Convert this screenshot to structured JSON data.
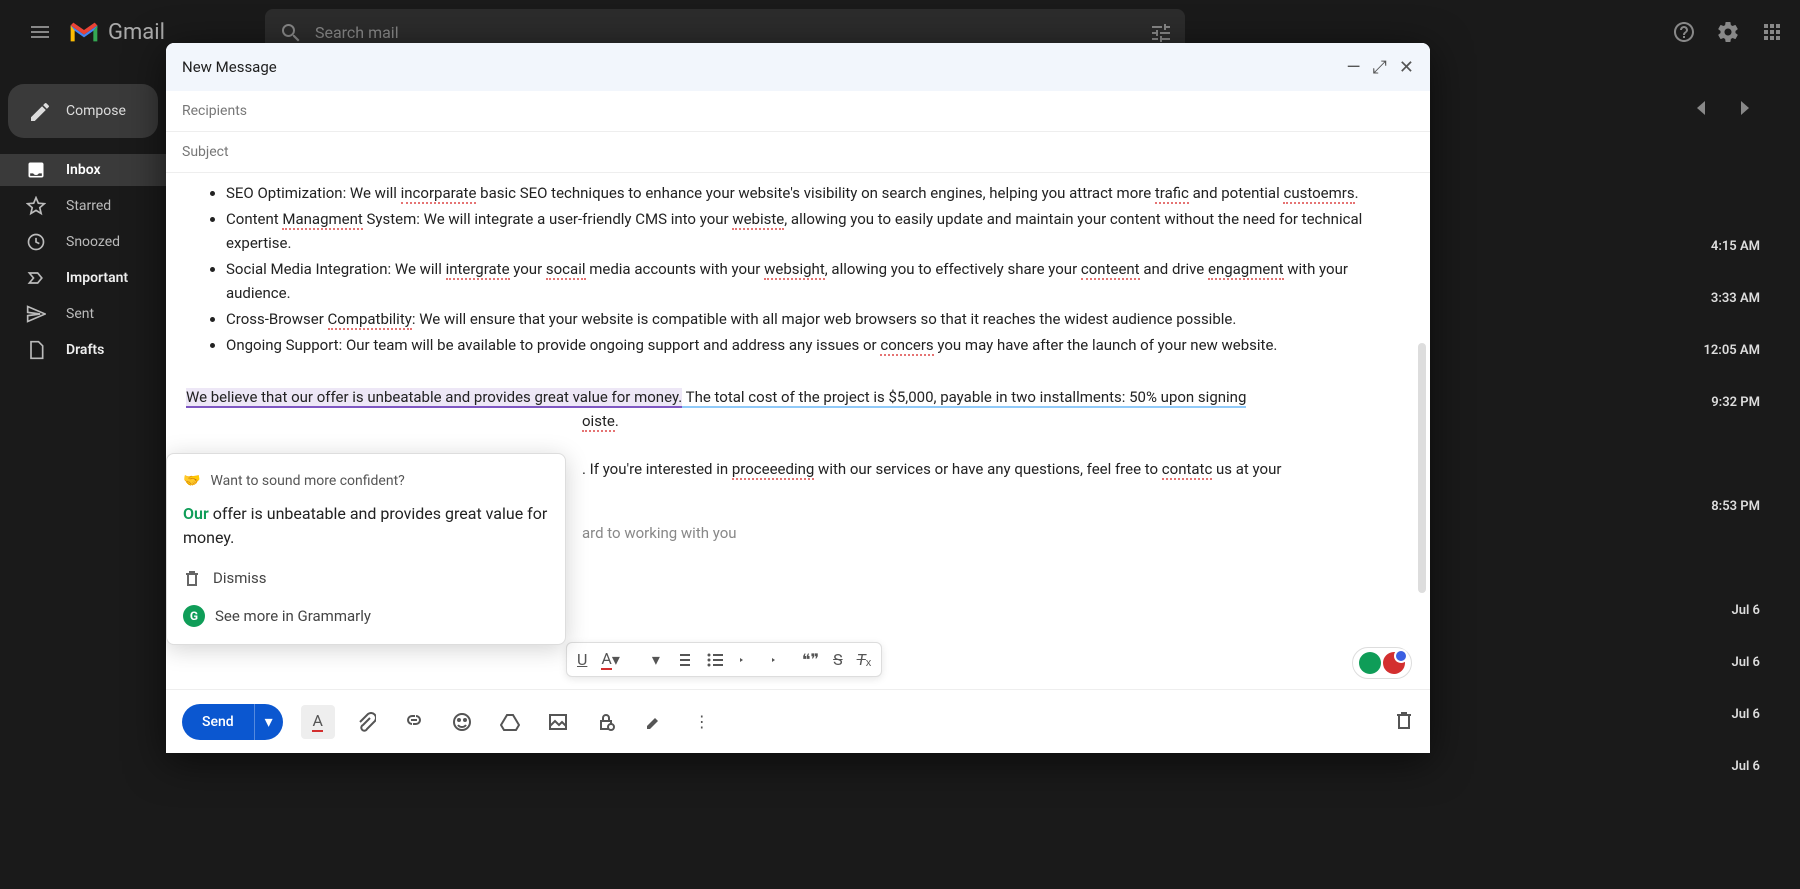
{
  "header": {
    "logo_text": "Gmail",
    "search_placeholder": "Search mail"
  },
  "sidebar": {
    "compose_label": "Compose",
    "items": [
      {
        "label": "Inbox",
        "icon": "inbox"
      },
      {
        "label": "Starred",
        "icon": "star"
      },
      {
        "label": "Snoozed",
        "icon": "clock"
      },
      {
        "label": "Important",
        "icon": "important"
      },
      {
        "label": "Sent",
        "icon": "send"
      },
      {
        "label": "Drafts",
        "icon": "draft"
      }
    ]
  },
  "times": [
    "4:15 AM",
    "3:33 AM",
    "12:05 AM",
    "9:32 PM",
    "",
    "8:53 PM",
    "",
    "Jul 6",
    "Jul 6",
    "Jul 6",
    "Jul 6"
  ],
  "compose": {
    "title": "New Message",
    "recipients_placeholder": "Recipients",
    "subject_placeholder": "Subject",
    "body": {
      "bullets": [
        {
          "prefix": "SEO Optimization: We will ",
          "sp1": "incorparate",
          "mid1": " basic SEO techniques to enhance your website's visibility on search engines, helping you attract more ",
          "sp2": "trafic",
          "mid2": " and potential ",
          "sp3": "custoemrs",
          "suffix": "."
        },
        {
          "prefix": "Content ",
          "sp1": "Managment",
          "mid1": " System: We will integrate a user-friendly CMS into your ",
          "sp2": "webiste",
          "suffix": ", allowing you to easily update and maintain your content without the need for technical expertise."
        },
        {
          "prefix": "Social Media Integration: We will ",
          "sp1": "intergrate",
          "mid1": " your ",
          "sp2": "socail",
          "mid2": " media accounts with your ",
          "sp3": "websight",
          "mid3": ", allowing you to effectively share your ",
          "sp4": "conteent",
          "mid4": " and drive ",
          "sp5": "engagment",
          "suffix": " with your audience."
        },
        {
          "prefix": "Cross-Browser ",
          "sp1": "Compatbility",
          "suffix": ": We will ensure that your website is compatible with all major web browsers so that it reaches the widest audience possible."
        },
        {
          "prefix": "Ongoing Support: Our team will be available to provide ongoing support and address any issues or ",
          "sp1": "concers",
          "suffix": " you may have after the launch of your new website."
        }
      ],
      "paragraph1": {
        "purple": "We believe that our offer is unbeatable and provides great value for money.",
        "blue": " The total cost of the project is $5,000, payable in two installments: 50% upon signing",
        "tail_spell": "oiste",
        "tail_dot": "."
      },
      "paragraph2": {
        "pre": ". If you're interested in ",
        "sp1": "proceeeding",
        "mid": " with our services or have any questions, feel free to ",
        "sp2": "contatc",
        "post": " us at your"
      },
      "paragraph3": "ard to working with you"
    },
    "send_label": "Send"
  },
  "grammarly": {
    "emoji": "🤝",
    "prompt": "Want to sound more confident?",
    "suggestion_green": "Our",
    "suggestion_rest": " offer is unbeatable and provides great value for money.",
    "dismiss": "Dismiss",
    "more": "See more in Grammarly"
  }
}
